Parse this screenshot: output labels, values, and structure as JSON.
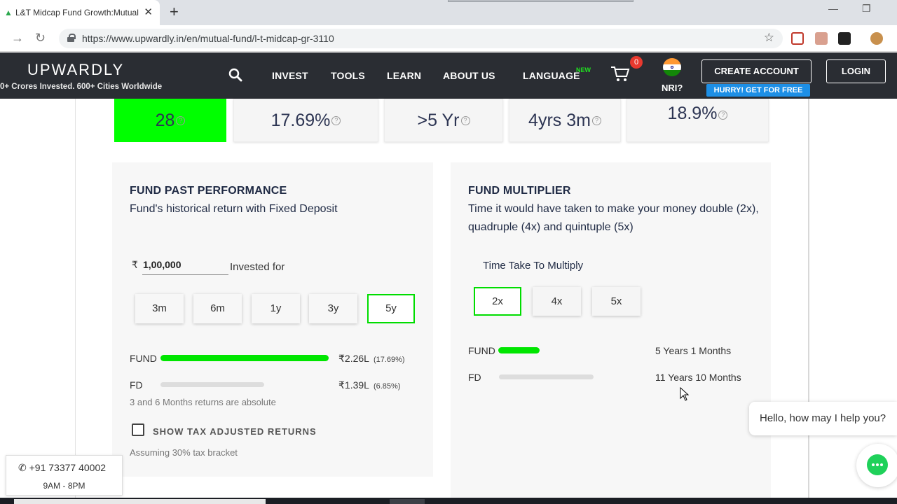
{
  "browser": {
    "tab_title": "L&T Midcap Fund Growth:Mutual",
    "url": "https://www.upwardly.in/en/mutual-fund/l-t-midcap-gr-3110"
  },
  "site": {
    "logo": "UPWARDLY",
    "tagline": "0+ Crores Invested. 600+ Cities Worldwide",
    "nav": [
      "INVEST",
      "TOOLS",
      "LEARN",
      "ABOUT US"
    ],
    "language": "LANGUAGE",
    "language_badge": "NEW",
    "cart_count": "0",
    "nri": "NRI?",
    "create_account": "CREATE ACCOUNT",
    "hurry": "HURRY! GET FOR FREE",
    "login": "LOGIN"
  },
  "stats": [
    "28",
    "17.69%",
    ">5 Yr",
    "4yrs 3m",
    "18.9%"
  ],
  "past_performance": {
    "title": "FUND PAST PERFORMANCE",
    "subtitle": "Fund's historical return with Fixed Deposit",
    "currency": "₹",
    "amount": "1,00,000",
    "invested_for": "Invested for",
    "periods": [
      "3m",
      "6m",
      "1y",
      "3y",
      "5y"
    ],
    "active_period": "5y",
    "fund_label": "FUND",
    "fund_value": "₹2.26L",
    "fund_pct": "(17.69%)",
    "fund_fill": 1.0,
    "fd_label": "FD",
    "fd_value": "₹1.39L",
    "fd_pct": "(6.85%)",
    "note": "3 and 6 Months returns are absolute",
    "tax_label": "SHOW TAX ADJUSTED RETURNS",
    "tax_note": "Assuming 30% tax bracket"
  },
  "multiplier": {
    "title": "FUND MULTIPLIER",
    "subtitle": "Time it would have taken to make your money double (2x), quadruple (4x) and quintuple (5x)",
    "time_label": "Time Take To Multiply",
    "options": [
      "2x",
      "4x",
      "5x"
    ],
    "active_option": "2x",
    "fund_label": "FUND",
    "fund_time": "5 Years 1 Months",
    "fd_label": "FD",
    "fd_time": "11 Years 10 Months"
  },
  "chat": {
    "greeting": "Hello, how may I help you?"
  },
  "contact": {
    "phone": "+91 73377 40002",
    "hours": "9AM - 8PM"
  },
  "colors": {
    "accent_green": "#00ff00",
    "header_bg": "#2a2d33",
    "badge_blue": "#1d8fe6"
  }
}
